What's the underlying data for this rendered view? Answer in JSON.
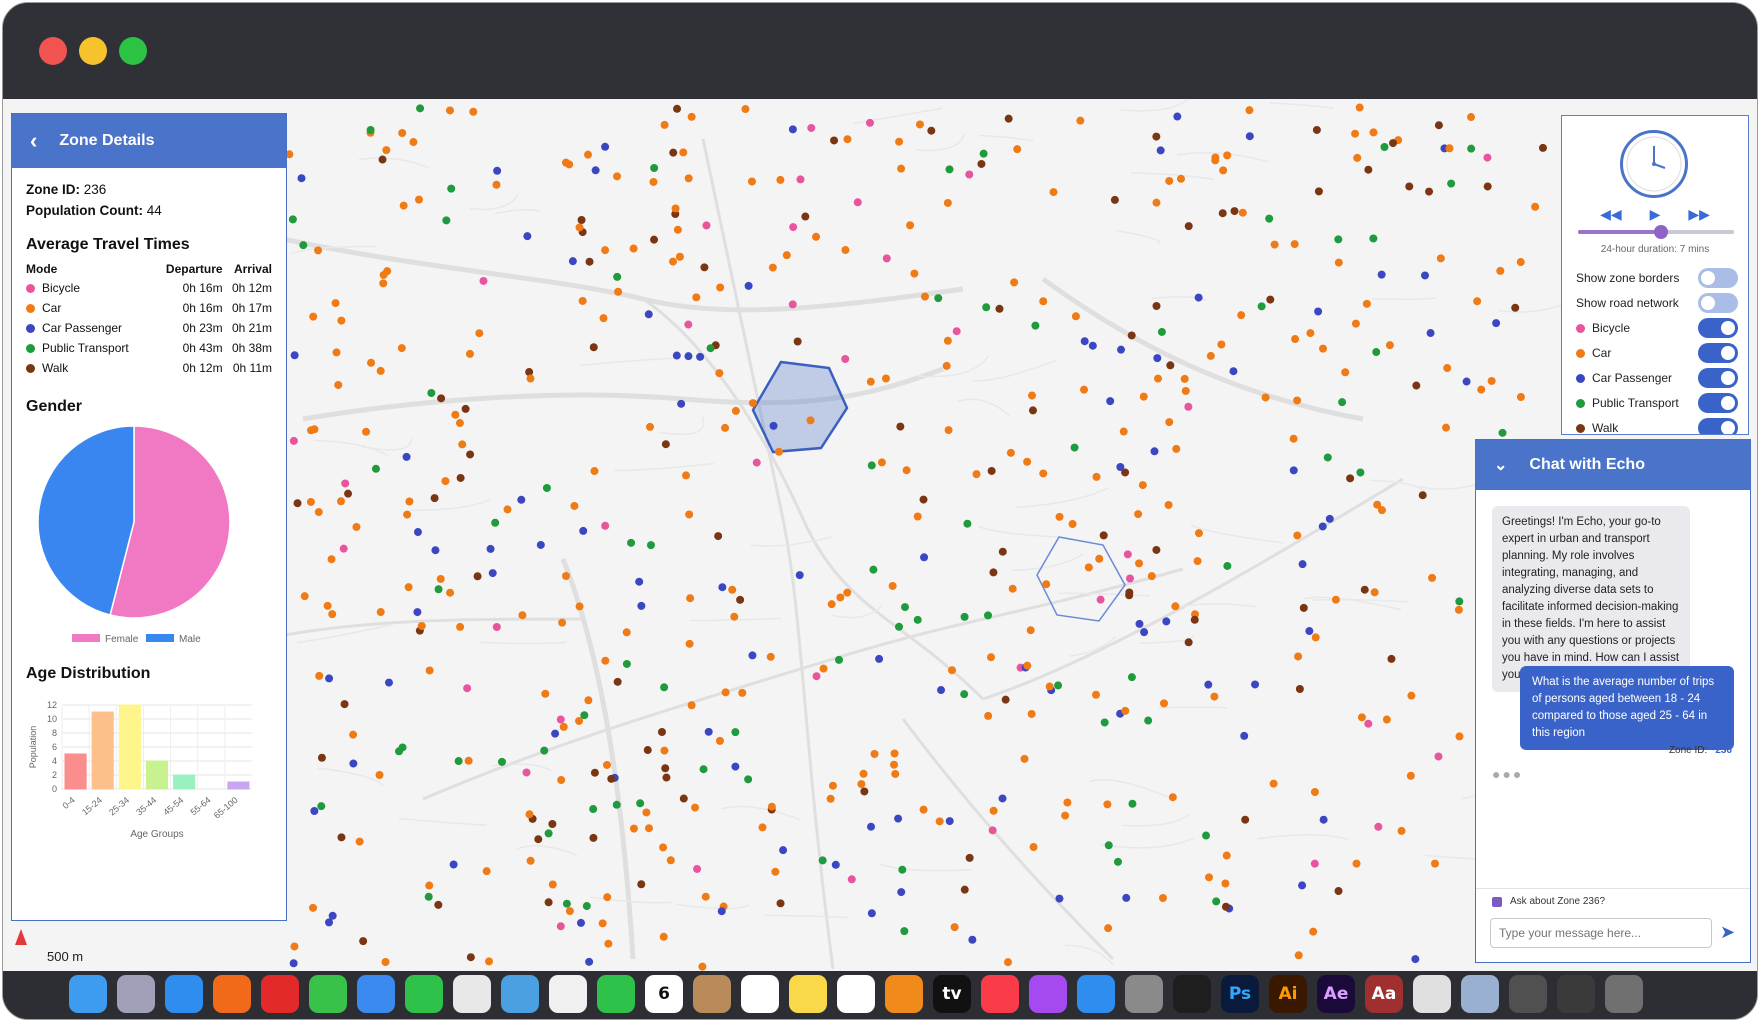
{
  "zone_panel": {
    "title": "Zone Details",
    "zone_id_label": "Zone ID:",
    "zone_id": "236",
    "population_label": "Population Count:",
    "population": "44",
    "travel_title": "Average Travel Times",
    "travel_headers": [
      "Mode",
      "Departure",
      "Arrival"
    ],
    "travel_rows": [
      {
        "mode": "Bicycle",
        "departure": "0h 16m",
        "arrival": "0h 12m",
        "color": "#e8559e"
      },
      {
        "mode": "Car",
        "departure": "0h 16m",
        "arrival": "0h 17m",
        "color": "#f07a14"
      },
      {
        "mode": "Car Passenger",
        "departure": "0h 23m",
        "arrival": "0h 21m",
        "color": "#3b47c2"
      },
      {
        "mode": "Public Transport",
        "departure": "0h 43m",
        "arrival": "0h 38m",
        "color": "#1f9a3c"
      },
      {
        "mode": "Walk",
        "departure": "0h 12m",
        "arrival": "0h 11m",
        "color": "#7a3512"
      }
    ],
    "gender_title": "Gender",
    "age_title": "Age Distribution"
  },
  "chart_data": [
    {
      "type": "pie",
      "title": "Gender",
      "categories": [
        "Female",
        "Male"
      ],
      "values": [
        54,
        46
      ],
      "colors": [
        "#f178c2",
        "#3a86f0"
      ]
    },
    {
      "type": "bar",
      "title": "Age Distribution",
      "categories": [
        "0-4",
        "15-24",
        "25-34",
        "35-44",
        "45-54",
        "55-64",
        "65-100"
      ],
      "values": [
        5,
        11,
        12,
        4,
        2,
        0,
        1
      ],
      "colors": [
        "#fb8d8d",
        "#fdc08a",
        "#fdf58a",
        "#c8f28f",
        "#9af1c0",
        "#b8c4f5",
        "#c9a6f1"
      ],
      "xlabel": "Age Groups",
      "ylabel": "Population",
      "ylim": [
        0,
        12
      ],
      "yticks": [
        0,
        2,
        4,
        6,
        8,
        10,
        12
      ]
    }
  ],
  "controls": {
    "duration": "24-hour duration: 7 mins",
    "slider_progress": 0.53,
    "toggles": [
      {
        "label": "Show zone borders",
        "on": false
      },
      {
        "label": "Show road network",
        "on": false
      },
      {
        "label": "Bicycle",
        "on": true,
        "color": "#e8559e"
      },
      {
        "label": "Car",
        "on": true,
        "color": "#f07a14"
      },
      {
        "label": "Car Passenger",
        "on": true,
        "color": "#3b47c2"
      },
      {
        "label": "Public Transport",
        "on": true,
        "color": "#1f9a3c"
      },
      {
        "label": "Walk",
        "on": true,
        "color": "#7a3512"
      }
    ]
  },
  "chat": {
    "title": "Chat with Echo",
    "bot_message": "Greetings! I'm Echo, your go-to expert in urban and transport planning. My role involves integrating, managing, and analyzing diverse data sets to facilitate informed decision-making in these fields. I'm here to assist you with any questions or projects you have in mind. How can I assist you today?",
    "user_message": "What is the average number of trips of persons aged between 18 - 24 compared to those aged 25 - 64 in this region",
    "zone_tag_label": "Zone ID:",
    "zone_tag_value": "236",
    "ask_label": "Ask about Zone 236?",
    "input_placeholder": "Type your message here..."
  },
  "map": {
    "scale_label": "500 m"
  },
  "dock": {
    "apps": [
      "Finder",
      "Launchpad",
      "Safari",
      "Firefox",
      "Opera",
      "Messages",
      "Mail",
      "WhatsApp",
      "Slack",
      "Maps",
      "Photos",
      "FaceTime",
      "Calendar",
      "Contacts",
      "Reminders",
      "Notes",
      "Freeform",
      "VLC",
      "Apple TV",
      "Music",
      "Podcasts",
      "App Store",
      "System Settings",
      "Figma",
      "Photoshop",
      "Illustrator",
      "After Effects",
      "Dictionary",
      "Font Book",
      "Preview",
      "Screenshot",
      "Terminal",
      "Trash"
    ],
    "calendar_month": "SEP",
    "calendar_day": "6",
    "ps": "Ps",
    "ai": "Ai",
    "ae": "Ae",
    "aa": "Aa",
    "tv": "tv"
  }
}
